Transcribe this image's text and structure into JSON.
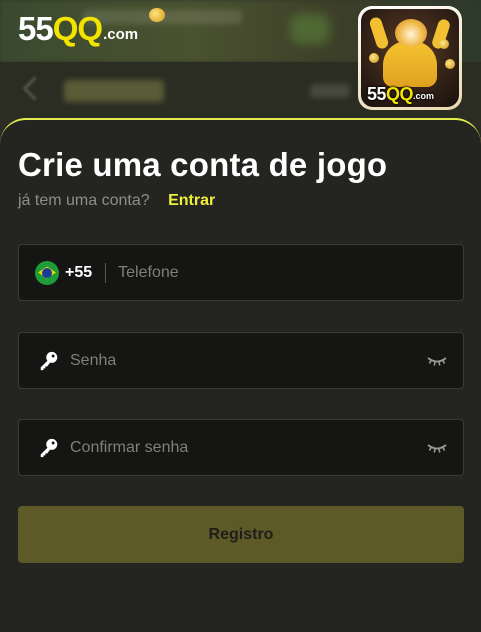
{
  "brand": {
    "name_digits": "55",
    "name_letters": "QQ",
    "domain_suffix": ".com"
  },
  "app_icon": {
    "digits": "55",
    "letters": "QQ",
    "suffix": ".com"
  },
  "form": {
    "title": "Crie uma conta de jogo",
    "has_account_text": "já tem uma conta?",
    "login_link": "Entrar",
    "phone": {
      "country_code": "+55",
      "country_flag": "brazil-flag-icon",
      "placeholder": "Telefone",
      "value": ""
    },
    "password": {
      "placeholder": "Senha",
      "value": "",
      "icon": "key-icon",
      "toggle_icon": "eye-closed-icon"
    },
    "confirm_password": {
      "placeholder": "Confirmar senha",
      "value": "",
      "icon": "key-icon",
      "toggle_icon": "eye-closed-icon"
    },
    "submit_label": "Registro"
  },
  "colors": {
    "accent": "#eef03a",
    "panel_bg": "#242421",
    "field_bg": "#151514",
    "submit_bg": "#5d5a28",
    "panel_border": "#e4ec50"
  }
}
